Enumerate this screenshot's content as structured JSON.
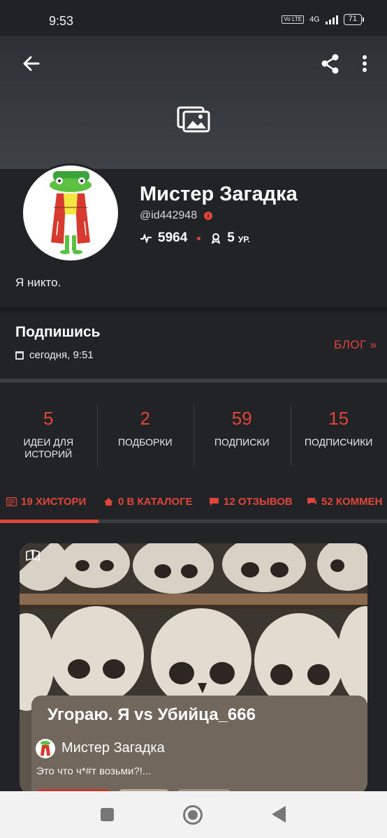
{
  "status_bar": {
    "time": "9:53",
    "network": "4G",
    "volte": "Vo LTE",
    "battery": "71"
  },
  "header": {
    "back_icon": "arrow-left-icon",
    "share_icon": "share-icon",
    "more_icon": "more-vertical-icon",
    "cover_icon": "images-icon"
  },
  "profile": {
    "name": "Мистер Загадка",
    "username": "@id442948",
    "rating": "5964",
    "level": "5",
    "level_unit": "УР.",
    "bio": "Я никто."
  },
  "subscribe": {
    "title": "Подпишись",
    "date": "сегодня, 9:51",
    "blog_link": "БЛОГ »"
  },
  "counters": [
    {
      "value": "5",
      "label": "ИДЕИ ДЛЯ ИСТОРИЙ"
    },
    {
      "value": "2",
      "label": "ПОДБОРКИ"
    },
    {
      "value": "59",
      "label": "ПОДПИСКИ"
    },
    {
      "value": "15",
      "label": "ПОДПИСЧИКИ"
    }
  ],
  "tabs": [
    {
      "label": "19 ХИСТОРИ",
      "icon": "stories-icon"
    },
    {
      "label": "0 В КАТАЛОГЕ",
      "icon": "home-icon"
    },
    {
      "label": "12 ОТЗЫВОВ",
      "icon": "review-icon"
    },
    {
      "label": "52 КОММЕН",
      "icon": "comments-icon"
    }
  ],
  "story_card": {
    "title": "Угораю. Я vs Убийца_666",
    "author": "Мистер Загадка",
    "snippet": "Это что ч*#т возьми?!...",
    "image_icon": "book-icon"
  },
  "colors": {
    "accent": "#e0453a",
    "background": "#222327",
    "card_panel": "#71675d"
  }
}
